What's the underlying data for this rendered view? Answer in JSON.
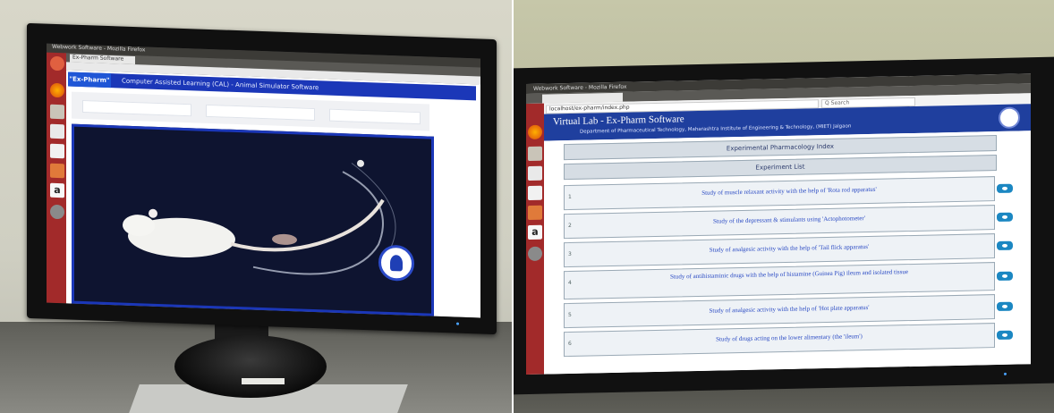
{
  "left_photo": {
    "window_title": "Webwork Software - Mozilla Firefox",
    "tab_title": "Ex-Pharm Software",
    "app_badge": "\"Ex-Pharm\"",
    "app_header_title": "Computer Assisted Learning (CAL) - Animal Simulator Software",
    "launcher_icons": [
      "ubuntu-icon",
      "firefox-icon",
      "files-icon",
      "document-icon",
      "text-icon",
      "presentation-icon",
      "amazon-icon",
      "settings-icon"
    ],
    "subject": "white laboratory rat on dark background",
    "colors": {
      "header_blue": "#1b37b8",
      "launcher_red": "#b02a2a",
      "canvas_dark": "#0e1430"
    }
  },
  "right_photo": {
    "window_title": "Webwork Software - Mozilla Firefox",
    "url_text": "localhost/ex-pharm/index.php",
    "search_text": "Q Search",
    "app_header_title": "Virtual Lab - Ex-Pharm Software",
    "app_subheader": "Department of Pharmaceutical Technology, Maharashtra Institute of Engineering & Technology, (MIET) Jalgaon",
    "menu_label": "Experimental Pharmacology Index",
    "list_label": "Experiment List",
    "experiments": [
      {
        "num": "1",
        "title": "Study of muscle relaxant activity with the help of 'Rota rod apparatus'"
      },
      {
        "num": "2",
        "title": "Study of the depressant & stimulants using 'Actophotometer'"
      },
      {
        "num": "3",
        "title": "Study of analgesic activity with the help of 'Tail flick apparatus'"
      },
      {
        "num": "4",
        "title": "Study of antihistaminic drugs with the help of histamine (Guinea Pig) ileum and isolated tissue"
      },
      {
        "num": "5",
        "title": "Study of analgesic activity with the help of 'Hot plate apparatus'"
      },
      {
        "num": "6",
        "title": "Study of drugs acting on the lower alimentary (the 'ileum')"
      }
    ],
    "colors": {
      "header_blue": "#1f3f9e",
      "row_bg": "#eef2f6",
      "button_blue": "#1b87c2"
    }
  }
}
